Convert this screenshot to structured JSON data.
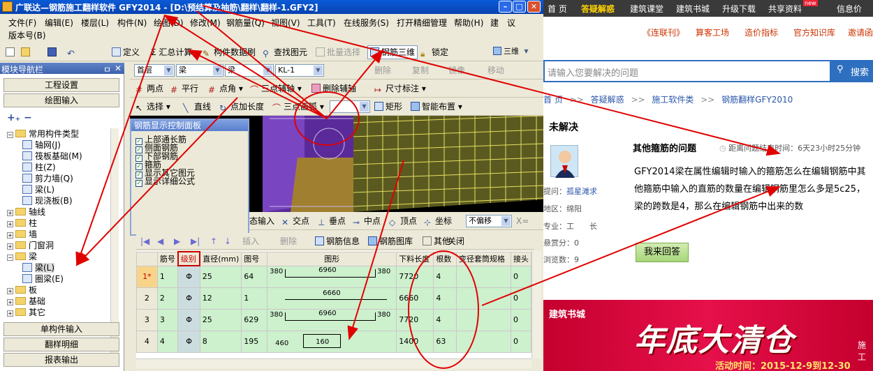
{
  "window": {
    "title": "广联达—钢筋施工翻样软件 GFY2014 - [D:\\预结算及抽筋\\翻样\\翻样-1.GFY2]",
    "min": "–",
    "max": "□",
    "close": "✕"
  },
  "menu": [
    "文件(F)",
    "编辑(E)",
    "楼层(L)",
    "构件(N)",
    "绘图(D)",
    "修改(M)",
    "钢筋量(Q)",
    "视图(V)",
    "工具(T)",
    "在线服务(S)",
    "打开精细管理",
    "帮助(H)",
    "建",
    "议"
  ],
  "menu2": "版本号(B)",
  "toolbar1": {
    "define": "定义",
    "sum": "Σ 汇总计算",
    "brush": "构件数据刷",
    "find": "查找图元",
    "batch": "批量选择",
    "rebar3d": "钢筋三维",
    "lock": "锁定",
    "view3d": "三维"
  },
  "toolbar2": {
    "floor": "首层",
    "cat": "梁",
    "type": "梁",
    "item": "KL-1",
    "delete": "删除",
    "copy": "复制",
    "mirror": "镜像",
    "move": "移动"
  },
  "toolbar3": {
    "twopoint": "两点",
    "parallel": "平行",
    "pointangle": "点角",
    "threepoint": "三点辅轴",
    "delaux": "删除辅轴",
    "dim": "尺寸标注"
  },
  "toolbar4": {
    "select": "选择",
    "line": "直线",
    "pointlen": "点加长度",
    "arc": "三点画弧",
    "rect": "矩形",
    "smart": "智能布置"
  },
  "nav": {
    "title": "模块导航栏",
    "pin": "ㅁ",
    "close": "✕",
    "project_settings": "工程设置",
    "drawing_input": "绘图输入",
    "single_input": "单构件输入",
    "detail": "翻样明细",
    "report": "报表输出",
    "tree": [
      {
        "label": "常用构件类型",
        "kind": "folder",
        "expand": "−",
        "level": 0
      },
      {
        "label": "轴网(J)",
        "kind": "item",
        "level": 1
      },
      {
        "label": "筏板基础(M)",
        "kind": "item",
        "level": 1
      },
      {
        "label": "柱(Z)",
        "kind": "item",
        "level": 1
      },
      {
        "label": "剪力墙(Q)",
        "kind": "item",
        "level": 1
      },
      {
        "label": "梁(L)",
        "kind": "item",
        "level": 1
      },
      {
        "label": "现浇板(B)",
        "kind": "item",
        "level": 1
      },
      {
        "label": "轴线",
        "kind": "folder",
        "expand": "+",
        "level": 0
      },
      {
        "label": "柱",
        "kind": "folder",
        "expand": "+",
        "level": 0
      },
      {
        "label": "墙",
        "kind": "folder",
        "expand": "+",
        "level": 0
      },
      {
        "label": "门窗洞",
        "kind": "folder",
        "expand": "+",
        "level": 0
      },
      {
        "label": "梁",
        "kind": "folder",
        "expand": "−",
        "level": 0
      },
      {
        "label": "梁(L)",
        "kind": "item",
        "level": 1
      },
      {
        "label": "圈梁(E)",
        "kind": "item",
        "level": 1
      },
      {
        "label": "板",
        "kind": "folder",
        "expand": "+",
        "level": 0
      },
      {
        "label": "基础",
        "kind": "folder",
        "expand": "+",
        "level": 0
      },
      {
        "label": "其它",
        "kind": "folder",
        "expand": "+",
        "level": 0
      }
    ]
  },
  "rebar_panel": {
    "title": "钢筋显示控制面板",
    "items": [
      "上部通长筋",
      "侧面钢筋",
      "下部钢筋",
      "箍筋",
      "显示其它图元",
      "显示详细公式"
    ]
  },
  "snap_bar": {
    "input": "态输入",
    "intersect": "交点",
    "perp": "垂点",
    "mid": "中点",
    "vertex": "顶点",
    "coord": "坐标",
    "offset": "不偏移",
    "x": "X="
  },
  "grid_toolbar": {
    "insert": "插入",
    "delete": "删除",
    "info": "钢筋信息",
    "lib": "钢筋图库",
    "other": "其他",
    "close": "关闭"
  },
  "grid": {
    "headers": [
      "筋号",
      "级别",
      "直径(mm)",
      "图号",
      "图形",
      "下料长度",
      "根数",
      "变径套筒规格",
      "接头"
    ],
    "rows": [
      {
        "rowno": "1*",
        "num": "1",
        "level": "Φ",
        "dia": "25",
        "fig": "64",
        "l": "380",
        "m": "6960",
        "r": "380",
        "len": "7720",
        "count": "4",
        "spec": "",
        "joint": "0"
      },
      {
        "rowno": "2",
        "num": "2",
        "level": "Φ",
        "dia": "12",
        "fig": "1",
        "l": "",
        "m": "6660",
        "r": "",
        "len": "6660",
        "count": "4",
        "spec": "",
        "joint": "0"
      },
      {
        "rowno": "3",
        "num": "3",
        "level": "Φ",
        "dia": "25",
        "fig": "629",
        "l": "380",
        "m": "6960",
        "r": "380",
        "len": "7720",
        "count": "4",
        "spec": "",
        "joint": "0"
      },
      {
        "rowno": "4",
        "num": "4",
        "level": "Φ",
        "dia": "8",
        "fig": "195",
        "l": "460",
        "m": "160",
        "r": "",
        "len": "1400",
        "count": "63",
        "spec": "",
        "joint": "0"
      }
    ]
  },
  "web": {
    "nav": [
      "首 页",
      "答疑解惑",
      "建筑课堂",
      "建筑书城",
      "升级下载",
      "共享资料",
      "信息价"
    ],
    "new_badge": "new",
    "sub": [
      "《连联刊》",
      "算客工场",
      "造价指标",
      "官方知识库",
      "邀请函"
    ],
    "search_placeholder": "请输入您要解决的问题",
    "search_btn": "搜索",
    "breadcrumb": [
      "首 页",
      "答疑解惑",
      "施工软件类",
      "钢筋翻样GFY2010"
    ],
    "sep": ">>",
    "status": "未解决",
    "question_title": "其他箍筋的问题",
    "countdown": "距离问题结束时间：6天23小时25分钟",
    "question_body": "GFY2014梁在属性编辑时输入的箍筋怎么在编辑钢筋中其他箍筋中输入的直筋的数量在编辑钢筋里怎么多是5c25，梁的跨数是4，那么在编辑钢筋中出来的数",
    "asker_label": "提问：",
    "asker": "孤星滩求",
    "region_label": "地区：",
    "region": "绵阳",
    "job_label": "专业：",
    "job": "工　　长",
    "reward_label": "悬赏分：",
    "reward": "0",
    "views_label": "浏览数：",
    "views": "9",
    "answer_btn": "我来回答",
    "banner_tag": "建筑书城",
    "banner_big": "年底大清仓",
    "banner_sub": "活动时间：2015-12-9到12-30",
    "banner_side": "施工"
  },
  "colors": {
    "arrow": "#e00000",
    "web_nav_hl": "#ffd200",
    "grid_row": "#cdf0cd",
    "accent": "#2f6fc0"
  }
}
